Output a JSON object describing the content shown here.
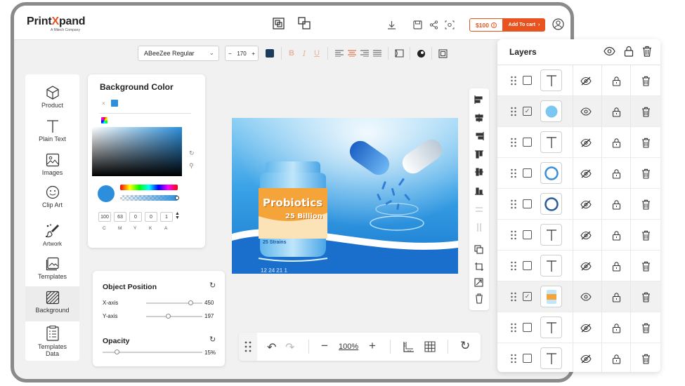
{
  "header": {
    "logo_text_a": "Print",
    "logo_text_x": "X",
    "logo_text_b": "pand",
    "logo_sub": "A Mitech Company",
    "price": "$100",
    "add_to_cart": "Add To cart"
  },
  "toolbar": {
    "font_name": "ABeeZee Regular",
    "font_size": "170",
    "minus": "−",
    "plus": "+",
    "text_color": "#1c3b5c"
  },
  "sidebar": {
    "items": [
      {
        "label": "Product",
        "icon": "cube-icon"
      },
      {
        "label": "Plain Text",
        "icon": "text-icon"
      },
      {
        "label": "Images",
        "icon": "image-icon"
      },
      {
        "label": "Clip Art",
        "icon": "smiley-icon"
      },
      {
        "label": "Artwork",
        "icon": "brush-icon"
      },
      {
        "label": "Templates",
        "icon": "templates-icon"
      },
      {
        "label": "Background",
        "icon": "background-icon"
      },
      {
        "label": "Templates",
        "label2": "Data",
        "icon": "templates-data-icon"
      }
    ]
  },
  "background_panel": {
    "title": "Background Color",
    "selected_color": "#2d8fdb",
    "cmyk": {
      "values": [
        "100",
        "63",
        "0",
        "0",
        "1"
      ],
      "labels": [
        "C",
        "M",
        "Y",
        "K",
        "A"
      ]
    }
  },
  "object_position": {
    "title": "Object Position",
    "x_label": "X-axis",
    "x_value": "450",
    "y_label": "Y-axis",
    "y_value": "197",
    "opacity_title": "Opacity",
    "opacity_value": "15%"
  },
  "canvas": {
    "product_title": "Probiotics",
    "product_sub": "25 Billion",
    "product_strains": "25 Strains",
    "bottom_text": "12 24 21 1"
  },
  "bottom_bar": {
    "zoom": "100%"
  },
  "layers": {
    "title": "Layers",
    "rows": [
      {
        "thumb": "text",
        "checked": false,
        "visible": false,
        "selected": false
      },
      {
        "thumb": "circle-filled",
        "checked": true,
        "visible": true,
        "selected": true
      },
      {
        "thumb": "text",
        "checked": false,
        "visible": false,
        "selected": false
      },
      {
        "thumb": "ring-blue",
        "checked": false,
        "visible": false,
        "selected": false
      },
      {
        "thumb": "ring-dark",
        "checked": false,
        "visible": false,
        "selected": false
      },
      {
        "thumb": "text",
        "checked": false,
        "visible": false,
        "selected": false
      },
      {
        "thumb": "text",
        "checked": false,
        "visible": false,
        "selected": false
      },
      {
        "thumb": "image",
        "checked": true,
        "visible": true,
        "selected": true
      },
      {
        "thumb": "text",
        "checked": false,
        "visible": false,
        "selected": false
      },
      {
        "thumb": "text",
        "checked": false,
        "visible": false,
        "selected": false
      }
    ]
  }
}
